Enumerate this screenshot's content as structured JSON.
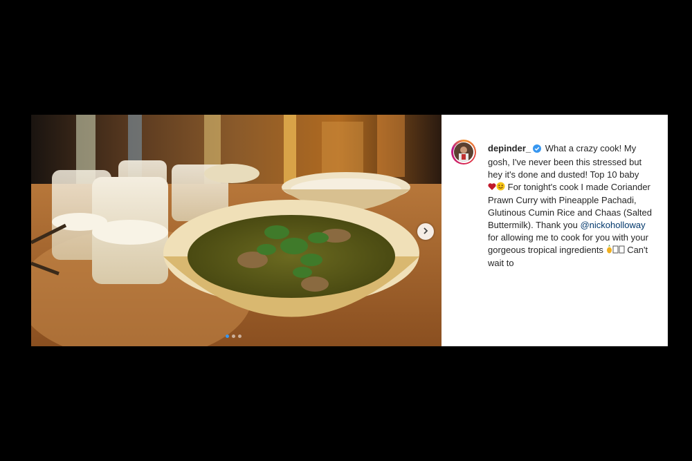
{
  "post": {
    "username": "depinder_",
    "caption_part1": "What a crazy cook! My gosh, I've never been this stressed but hey it's done and dusted! Top 10 baby",
    "caption_part2": "For tonight's cook I made Coriander Prawn Curry with Pineapple Pachadi, Glutinous Cumin Rice and Chaas (Salted Buttermilk). Thank you",
    "mention": "@nickoholloway",
    "caption_part3": "for allowing me to cook for you with your gorgeous tropical ingredients",
    "caption_part4": "Can't wait to",
    "emojis": [
      "heart-emoji",
      "smile-emoji",
      "pineapple-emoji",
      "missing-glyph",
      "missing-glyph"
    ],
    "carousel": {
      "total_slides": 3,
      "active_slide": 1
    },
    "colors": {
      "accent": "#3897f0",
      "mention": "#00376b",
      "text": "#262626",
      "background": "#000000"
    }
  }
}
